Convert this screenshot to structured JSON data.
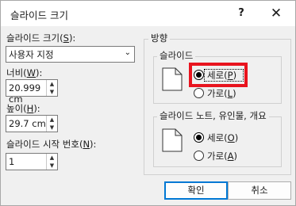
{
  "window": {
    "title": "슬라이드 크기",
    "help_label": "?",
    "close_label": "✕"
  },
  "slide_size": {
    "label_text": "슬라이드 크기(",
    "label_key": "S",
    "label_end": "):",
    "selected_value": "사용자 지정"
  },
  "width": {
    "label_text": "너비(",
    "label_key": "W",
    "label_end": "):",
    "value": "20.999 cm"
  },
  "height": {
    "label_text": "높이(",
    "label_key": "H",
    "label_end": "):",
    "value": "29.7 cm"
  },
  "numbering": {
    "label_text": "슬라이드 시작 번호(",
    "label_key": "N",
    "label_end": "):",
    "value": "1"
  },
  "orientation": {
    "group_title": "방향",
    "slides": {
      "title": "슬라이드",
      "portrait_text": "세로(",
      "portrait_key": "P",
      "portrait_end": ")",
      "landscape_text": "가로(",
      "landscape_key": "L",
      "landscape_end": ")",
      "selected": "portrait"
    },
    "notes": {
      "title": "슬라이드 노트, 유인물, 개요",
      "portrait_text": "세로(",
      "portrait_key": "O",
      "portrait_end": ")",
      "landscape_text": "가로(",
      "landscape_key": "A",
      "landscape_end": ")",
      "selected": "portrait"
    }
  },
  "buttons": {
    "ok": "확인",
    "cancel": "취소"
  },
  "highlight_color": "#e8141e",
  "accent_color": "#0078d4"
}
